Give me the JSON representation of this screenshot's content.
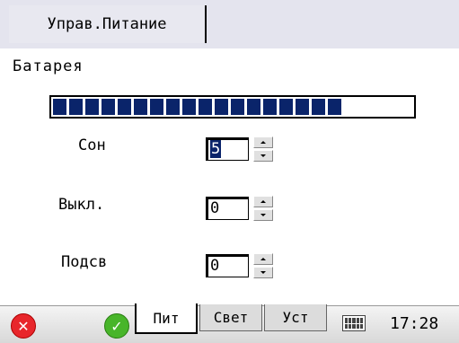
{
  "window": {
    "title": "Управ.Питание"
  },
  "battery": {
    "label": "Батарея",
    "level_percent": 90,
    "segments_filled": 18,
    "segments_total": 20
  },
  "settings": [
    {
      "label": "Сон",
      "value": "5",
      "selected": true
    },
    {
      "label": "Выкл.",
      "value": "0",
      "selected": false
    },
    {
      "label": "Подсв",
      "value": "0",
      "selected": false
    }
  ],
  "taskbar": {
    "tabs": [
      {
        "label": "Пит",
        "active": true
      },
      {
        "label": "Свет",
        "active": false
      },
      {
        "label": "Уст",
        "active": false
      }
    ],
    "clock": "17:28",
    "colors": {
      "close": "#e8262b",
      "ok": "#48b52a",
      "selection": "#0a246a"
    }
  }
}
